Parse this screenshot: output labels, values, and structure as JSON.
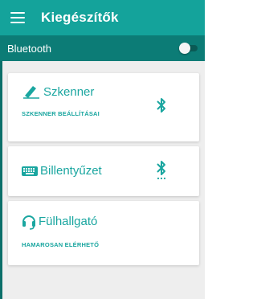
{
  "appbar": {
    "title": "Kiegészítők",
    "menu_icon": "hamburger-menu-icon",
    "color": "#14a39b"
  },
  "bluetooth_bar": {
    "label": "Bluetooth",
    "toggle_on": false,
    "color": "#0c7c76"
  },
  "cards": [
    {
      "title": "Szkenner",
      "subtitle": "SZKENNER BEÁLLÍTÁSAI",
      "icon": "pen-icon",
      "status_icon": "bluetooth-icon"
    },
    {
      "title": "Billentyűzet",
      "icon": "keyboard-icon",
      "status_icon": "bluetooth-searching-icon"
    },
    {
      "title": "Fülhallgató",
      "subtitle": "HAMAROSAN ELÉRHETŐ",
      "icon": "headset-icon"
    }
  ],
  "colors": {
    "accent": "#1aa6a0",
    "background": "#eeeeee"
  }
}
